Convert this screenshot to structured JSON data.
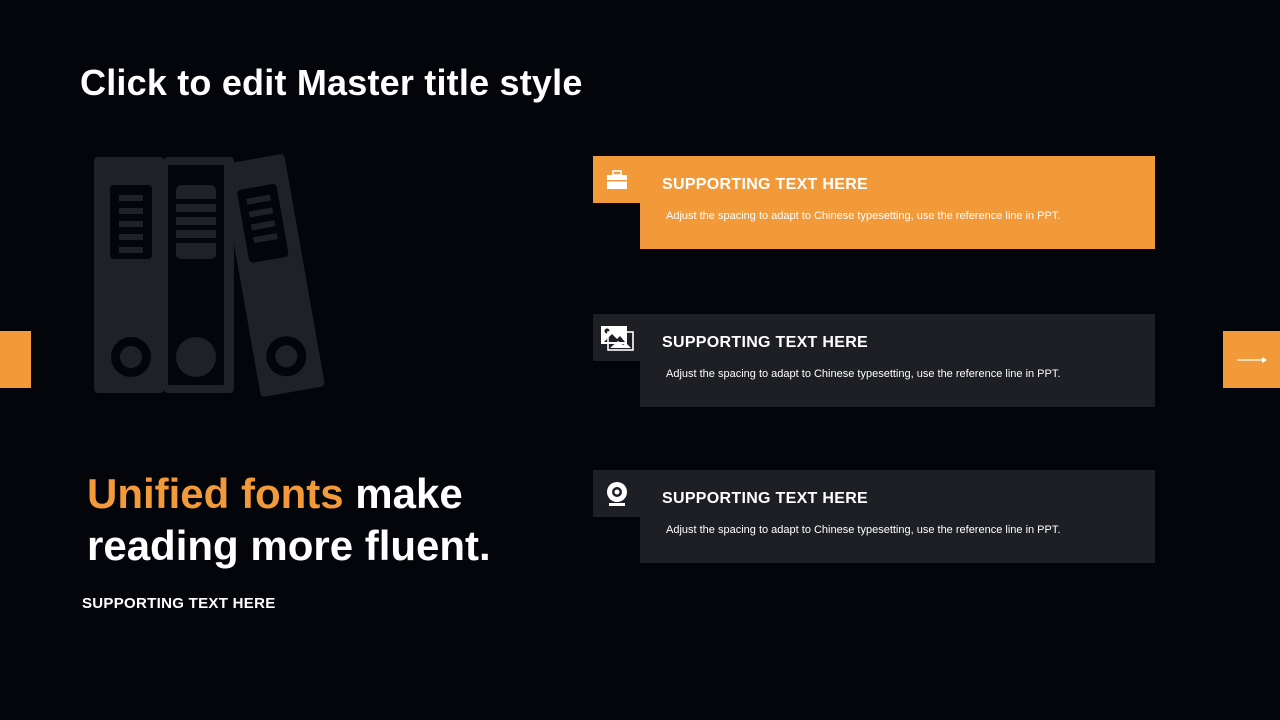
{
  "slide": {
    "title": "Click to edit Master title style",
    "tagline": {
      "accent": "Unified fonts",
      "rest_line1": " make",
      "line2": "reading more fluent."
    },
    "subtitle": "SUPPORTING TEXT HERE"
  },
  "colors": {
    "background": "#03050a",
    "accent": "#f2993a",
    "card": "#1d1f24",
    "binder": "#1e2126"
  },
  "illustration": {
    "icon": "binders-icon"
  },
  "cards": [
    {
      "icon": "briefcase-icon",
      "heading": "SUPPORTING TEXT HERE",
      "text": "Adjust the spacing to adapt to Chinese typesetting, use the reference line in PPT.",
      "highlighted": true
    },
    {
      "icon": "image-icon",
      "heading": "SUPPORTING TEXT HERE",
      "text": "Adjust the spacing to adapt to Chinese typesetting, use the reference line in PPT.",
      "highlighted": false
    },
    {
      "icon": "webcam-icon",
      "heading": "SUPPORTING TEXT HERE",
      "text": "Adjust the spacing to adapt to Chinese typesetting, use the reference line in PPT.",
      "highlighted": false
    }
  ],
  "navigation": {
    "next_icon": "arrow-right-icon"
  }
}
